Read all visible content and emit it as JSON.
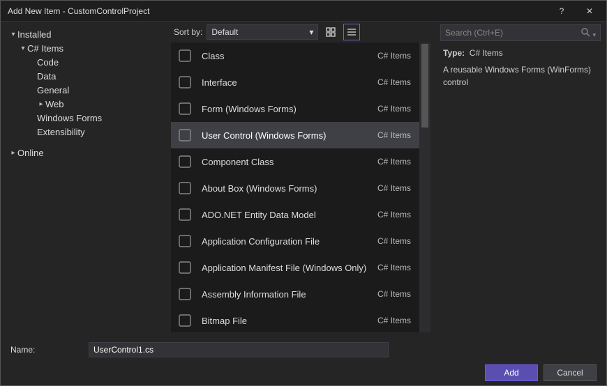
{
  "window": {
    "title": "Add New Item - CustomControlProject",
    "help": "?",
    "close": "✕"
  },
  "sidebar": {
    "nodes": [
      {
        "label": "Installed",
        "expand": "▾",
        "level": 0
      },
      {
        "label": "C# Items",
        "expand": "▾",
        "level": 1
      },
      {
        "label": "Code",
        "expand": "",
        "level": 2
      },
      {
        "label": "Data",
        "expand": "",
        "level": 2
      },
      {
        "label": "General",
        "expand": "",
        "level": 2
      },
      {
        "label": "Web",
        "expand": "▸",
        "level": 2
      },
      {
        "label": "Windows Forms",
        "expand": "",
        "level": 2
      },
      {
        "label": "Extensibility",
        "expand": "",
        "level": 2
      },
      {
        "label": "Online",
        "expand": "▸",
        "level": 0
      }
    ]
  },
  "toolbar": {
    "sort_label": "Sort by:",
    "sort_value": "Default"
  },
  "items": [
    {
      "label": "Class",
      "cat": "C# Items"
    },
    {
      "label": "Interface",
      "cat": "C# Items"
    },
    {
      "label": "Form (Windows Forms)",
      "cat": "C# Items"
    },
    {
      "label": "User Control (Windows Forms)",
      "cat": "C# Items",
      "selected": true
    },
    {
      "label": "Component Class",
      "cat": "C# Items"
    },
    {
      "label": "About Box (Windows Forms)",
      "cat": "C# Items"
    },
    {
      "label": "ADO.NET Entity Data Model",
      "cat": "C# Items"
    },
    {
      "label": "Application Configuration File",
      "cat": "C# Items"
    },
    {
      "label": "Application Manifest File (Windows Only)",
      "cat": "C# Items"
    },
    {
      "label": "Assembly Information File",
      "cat": "C# Items"
    },
    {
      "label": "Bitmap File",
      "cat": "C# Items"
    }
  ],
  "search": {
    "placeholder": "Search (Ctrl+E)"
  },
  "detail": {
    "type_label": "Type:",
    "type_value": "C# Items",
    "description": "A reusable Windows Forms (WinForms) control"
  },
  "name_row": {
    "label": "Name:",
    "value": "UserControl1.cs"
  },
  "buttons": {
    "add": "Add",
    "cancel": "Cancel"
  }
}
